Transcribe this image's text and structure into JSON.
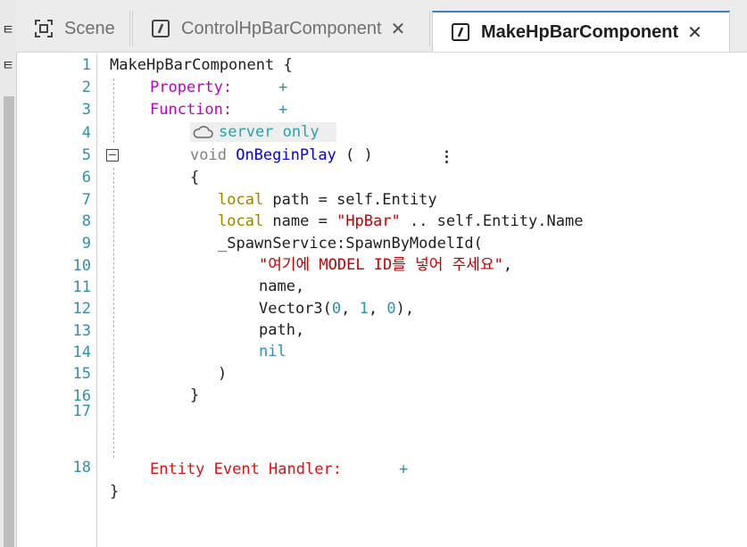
{
  "left_strip": {
    "top_label": "ㅌ",
    "second_label": "ㅌ"
  },
  "tabs": [
    {
      "label": "Scene",
      "icon": "scene-icon",
      "closable": false,
      "active": false
    },
    {
      "label": "ControlHpBarComponent",
      "icon": "script-icon",
      "closable": true,
      "active": false
    },
    {
      "label": "MakeHpBarComponent",
      "icon": "script-icon",
      "closable": true,
      "active": true
    }
  ],
  "close_glyph": "✕",
  "line_numbers": [
    "1",
    "2",
    "3",
    "4",
    "5",
    "6",
    "7",
    "8",
    "9",
    "10",
    "11",
    "12",
    "13",
    "14",
    "15",
    "16",
    "17",
    "18"
  ],
  "code": {
    "l1": "MakeHpBarComponent {",
    "l2_kw": "Property:",
    "l2_plus": "+",
    "l3_kw": "Function:",
    "l3_plus": "+",
    "l4_badge": "server only",
    "l5_void": "void",
    "l5_fn": "OnBeginPlay",
    "l5_parens": "( )",
    "l5_menu": "⋮",
    "l6": "{",
    "l7_local": "local",
    "l7_rest": " path = self.Entity",
    "l8_local": "local",
    "l8_mid": " name = ",
    "l8_str": "\"HpBar\"",
    "l8_rest": " .. self.Entity.Name",
    "l9": "_SpawnService:SpawnByModelId(",
    "l10_str": "\"여기에 MODEL ID를 넣어 주세요\"",
    "l10_rest": ",",
    "l11": "name,",
    "l12_a": "Vector3(",
    "l12_n0": "0",
    "l12_c1": ", ",
    "l12_n1": "1",
    "l12_c2": ", ",
    "l12_n2": "0",
    "l12_b": "),",
    "l13": "path,",
    "l14": "nil",
    "l15": ")",
    "l16": "}",
    "l18_kw": "Entity Event Handler:",
    "l18_plus": "+",
    "l19": "}"
  },
  "colors": {
    "accent_tab": "#3c7fc9",
    "line_number": "#2b91af",
    "property_keyword": "#c000c0",
    "local_keyword": "#a08000",
    "string": "#c00000",
    "event_handler": "#e01010",
    "server_badge_text": "#2aa0a8"
  }
}
